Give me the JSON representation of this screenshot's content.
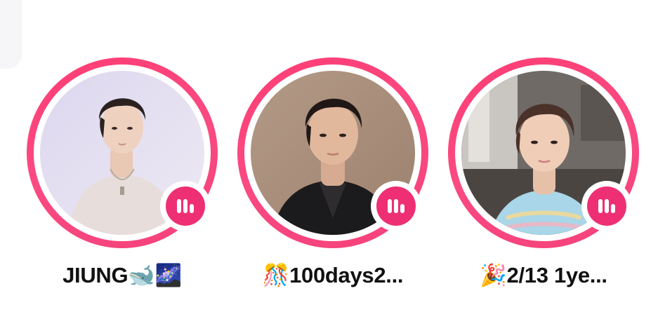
{
  "stories": [
    {
      "name": "JIUNG🐋🌌",
      "has_live_badge": true,
      "avatar_scene": "person-light-background"
    },
    {
      "name": "🎊100days2...",
      "has_live_badge": true,
      "avatar_scene": "person-brown-background"
    },
    {
      "name": "🎉2/13 1ye...",
      "has_live_badge": true,
      "avatar_scene": "person-room-background"
    }
  ],
  "colors": {
    "ring": "#f4417b",
    "badge": "#ee2f73",
    "text": "#111111",
    "background": "#ffffff"
  },
  "icons": {
    "badge_icon": "bar-chart-icon"
  }
}
